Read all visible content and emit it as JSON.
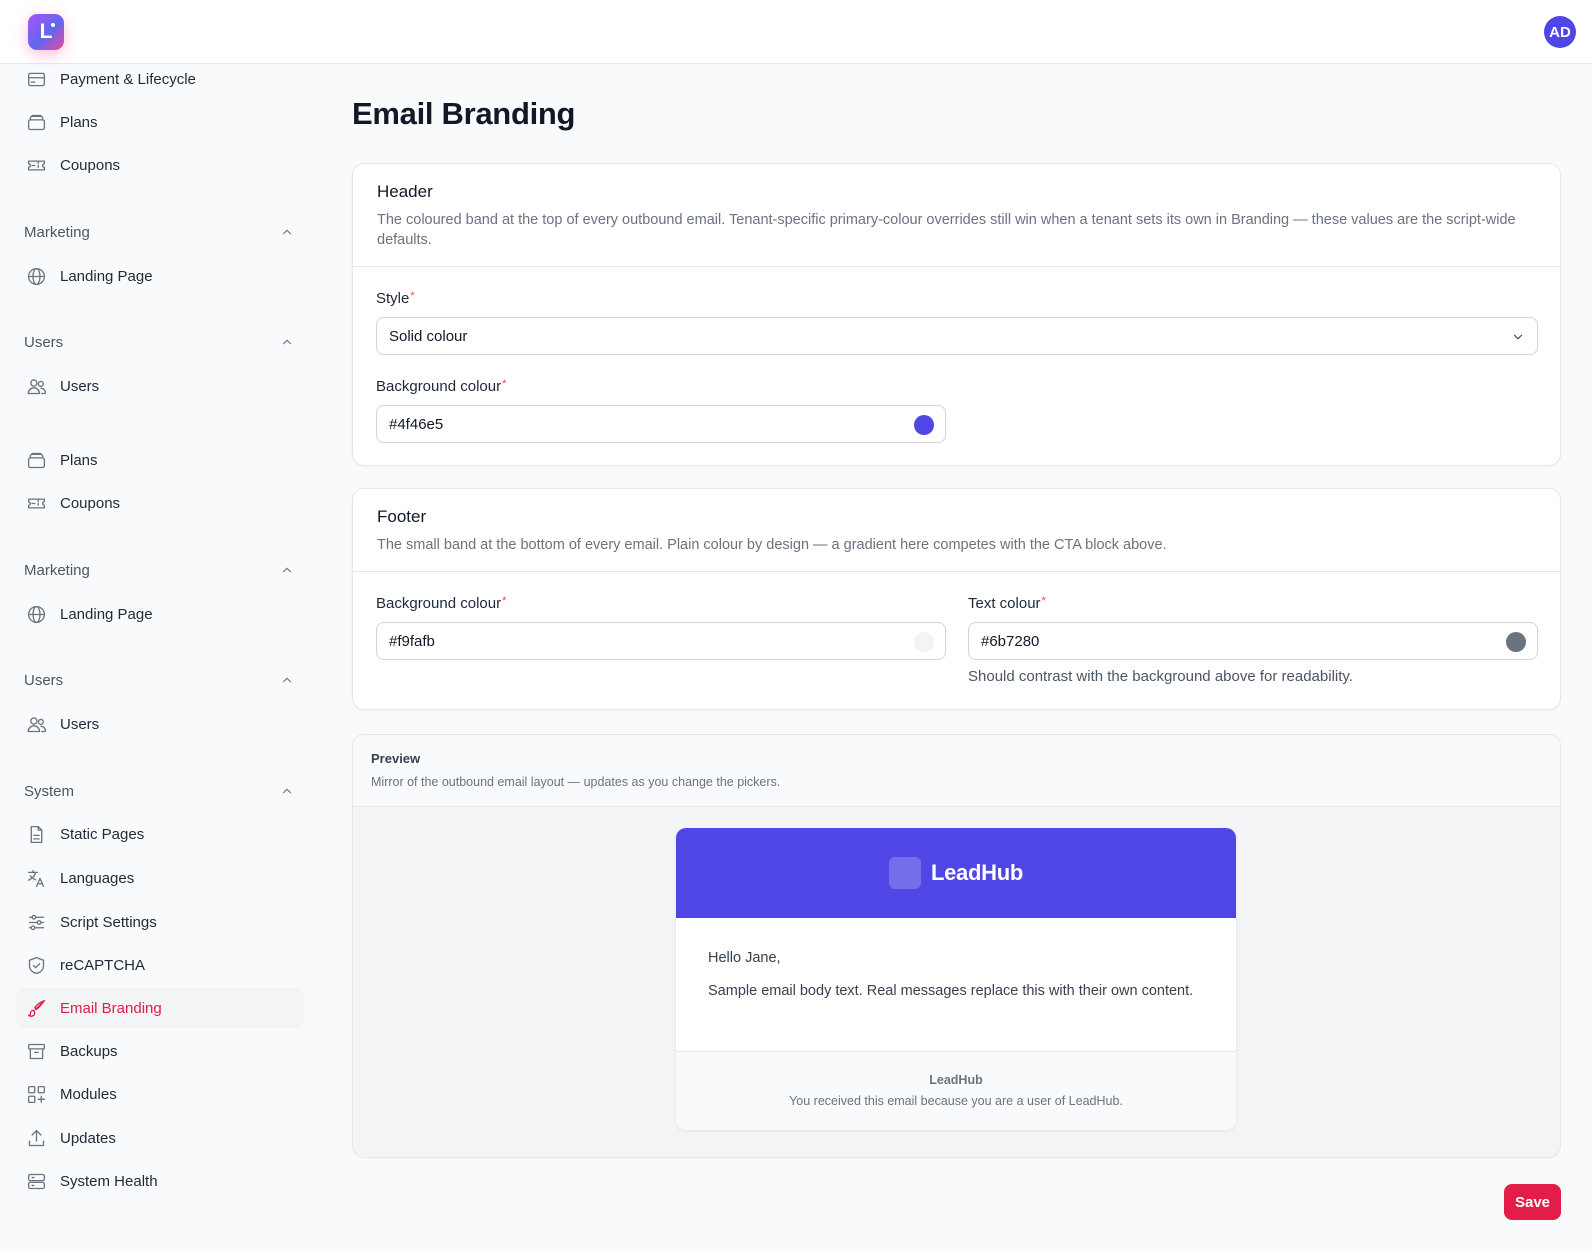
{
  "app": {
    "logo_letter": "L",
    "avatar_initials": "AD"
  },
  "sidebar": {
    "items_top": [
      {
        "label": "Payment & Lifecycle",
        "icon": "credit-card-icon"
      },
      {
        "label": "Plans",
        "icon": "layers-icon"
      },
      {
        "label": "Coupons",
        "icon": "ticket-icon"
      }
    ],
    "groups": [
      {
        "label": "Marketing",
        "items": [
          {
            "label": "Landing Page",
            "icon": "globe-icon"
          }
        ]
      },
      {
        "label": "Users",
        "items": [
          {
            "label": "Users",
            "icon": "users-icon"
          }
        ]
      },
      {
        "label": "",
        "items": [
          {
            "label": "Plans",
            "icon": "layers-icon"
          },
          {
            "label": "Coupons",
            "icon": "ticket-icon"
          }
        ]
      },
      {
        "label": "Marketing",
        "items": [
          {
            "label": "Landing Page",
            "icon": "globe-icon"
          }
        ]
      },
      {
        "label": "Users",
        "items": [
          {
            "label": "Users",
            "icon": "users-icon"
          }
        ]
      },
      {
        "label": "System",
        "items": [
          {
            "label": "Static Pages",
            "icon": "file-icon"
          },
          {
            "label": "Languages",
            "icon": "translate-icon"
          },
          {
            "label": "Script Settings",
            "icon": "sliders-icon"
          },
          {
            "label": "reCAPTCHA",
            "icon": "shield-check-icon"
          },
          {
            "label": "Email Branding",
            "icon": "brush-icon",
            "active": true
          },
          {
            "label": "Backups",
            "icon": "archive-icon"
          },
          {
            "label": "Modules",
            "icon": "modules-icon"
          },
          {
            "label": "Updates",
            "icon": "upload-icon"
          },
          {
            "label": "System Health",
            "icon": "server-icon"
          }
        ]
      }
    ]
  },
  "page": {
    "title": "Email Branding"
  },
  "header_card": {
    "title": "Header",
    "description": "The coloured band at the top of every outbound email. Tenant-specific primary-colour overrides still win when a tenant sets its own in Branding — these values are the script-wide defaults.",
    "style_label": "Style",
    "style_value": "Solid colour",
    "bg_label": "Background colour",
    "bg_value": "#4f46e5"
  },
  "footer_card": {
    "title": "Footer",
    "description": "The small band at the bottom of every email. Plain colour by design — a gradient here competes with the CTA block above.",
    "bg_label": "Background colour",
    "bg_value": "#f9fafb",
    "text_label": "Text colour",
    "text_value": "#6b7280",
    "text_hint": "Should contrast with the background above for readability."
  },
  "preview": {
    "title": "Preview",
    "description": "Mirror of the outbound email layout — updates as you change the pickers.",
    "brand": "LeadHub",
    "greeting": "Hello Jane,",
    "body": "Sample email body text. Real messages replace this with their own content.",
    "footer_brand": "LeadHub",
    "footer_note": "You received this email because you are a user of LeadHub."
  },
  "actions": {
    "save_label": "Save"
  },
  "colors": {
    "accent": "#e11d48",
    "header_bg": "#4f46e5",
    "footer_bg": "#f9fafb",
    "footer_text": "#6b7280"
  }
}
